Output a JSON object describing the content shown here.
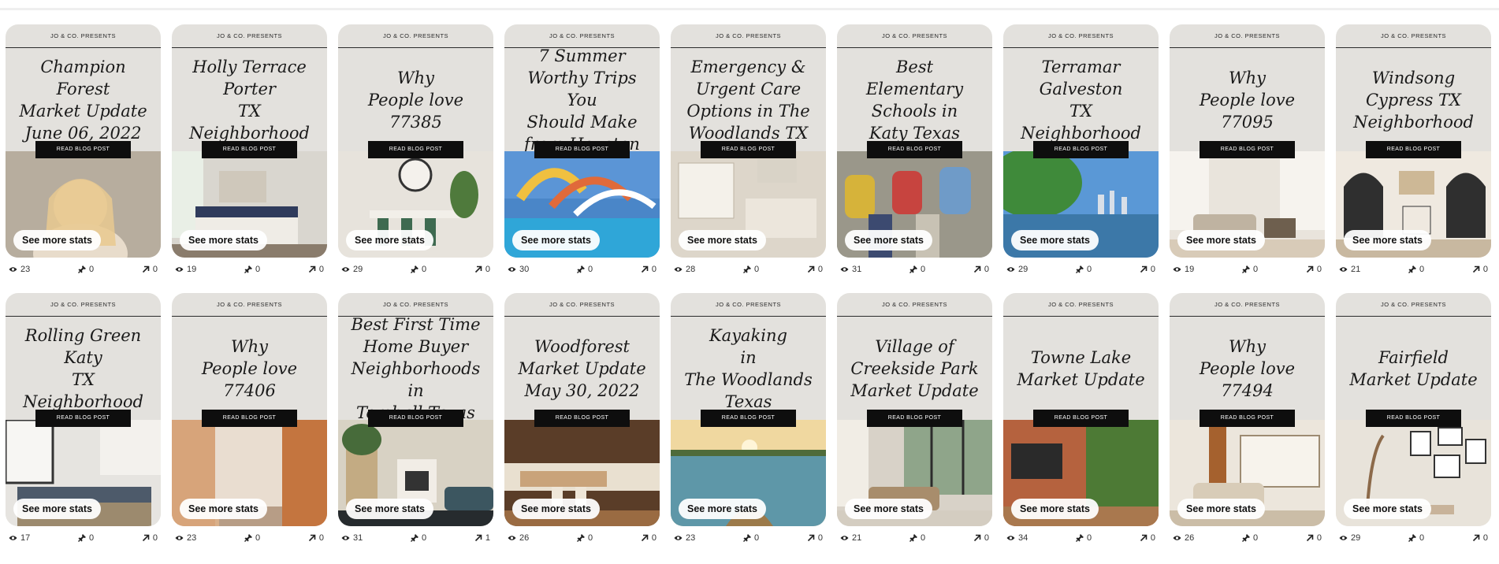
{
  "cards": [
    {
      "title": "Champion Forest\nMarket Update\nJune 06, 2022",
      "views": "23",
      "saves": "0",
      "clicks": "0",
      "scene": "portrait",
      "palette": [
        "#c9c2b6",
        "#7b6a55",
        "#e9d3b4"
      ]
    },
    {
      "title": "Holly Terrace\nPorter\nTX\nNeighborhood",
      "views": "19",
      "saves": "0",
      "clicks": "0",
      "scene": "bedroom",
      "palette": [
        "#d9d6cf",
        "#8a7c6c",
        "#f2efe8"
      ]
    },
    {
      "title": "Why\nPeople love\n77385",
      "views": "29",
      "saves": "0",
      "clicks": "0",
      "scene": "dining",
      "palette": [
        "#e7e3dc",
        "#3e6a50",
        "#b8ad9d"
      ]
    },
    {
      "title": "7 Summer\nWorthy Trips You\nShould Make\nfrom Houston",
      "views": "30",
      "saves": "0",
      "clicks": "0",
      "scene": "waterpark",
      "palette": [
        "#4a86c8",
        "#2fa8d8",
        "#e2b04a"
      ]
    },
    {
      "title": "Emergency &\nUrgent Care\nOptions in The\nWoodlands TX",
      "views": "28",
      "saves": "0",
      "clicks": "0",
      "scene": "clinic",
      "palette": [
        "#ddd6ca",
        "#a89a86",
        "#f4efe6"
      ]
    },
    {
      "title": "Best\nElementary\nSchools in\nKaty Texas",
      "views": "31",
      "saves": "0",
      "clicks": "0",
      "scene": "kids",
      "palette": [
        "#8c8a7e",
        "#d6b33a",
        "#c7443f"
      ]
    },
    {
      "title": "Terramar\nGalveston\nTX\nNeighborhood",
      "views": "29",
      "saves": "0",
      "clicks": "0",
      "scene": "lake",
      "palette": [
        "#5a98d6",
        "#3f8a3a",
        "#3c78a8"
      ]
    },
    {
      "title": "Why\nPeople love\n77095",
      "views": "19",
      "saves": "0",
      "clicks": "0",
      "scene": "living",
      "palette": [
        "#e9e4dc",
        "#bfb3a1",
        "#6e5f4e"
      ]
    },
    {
      "title": "Windsong\nCypress TX\nNeighborhood",
      "views": "21",
      "saves": "0",
      "clicks": "0",
      "scene": "arches",
      "palette": [
        "#efe9e0",
        "#2f2f2f",
        "#c8b8a0"
      ]
    },
    {
      "title": "Rolling Green\nKaty\nTX\nNeighborhood",
      "views": "17",
      "saves": "0",
      "clicks": "0",
      "scene": "kitchen",
      "palette": [
        "#e6e4e0",
        "#4d5a6a",
        "#9c8a6e"
      ]
    },
    {
      "title": "Why\nPeople love\n77406",
      "views": "23",
      "saves": "0",
      "clicks": "0",
      "scene": "street",
      "palette": [
        "#d9b08a",
        "#c4753f",
        "#e8d4bf"
      ]
    },
    {
      "title": "Best First Time\nHome Buyer\nNeighborhoods in\nTomball Texas",
      "views": "31",
      "saves": "0",
      "clicks": "1",
      "scene": "plants",
      "palette": [
        "#d8d2c4",
        "#476b3a",
        "#3c5660"
      ]
    },
    {
      "title": "Woodforest\nMarket Update\nMay 30, 2022",
      "views": "26",
      "saves": "0",
      "clicks": "0",
      "scene": "kitchen2",
      "palette": [
        "#5a3d28",
        "#c9a37a",
        "#efe6d8"
      ]
    },
    {
      "title": "Kayaking\nin\nThe Woodlands\nTexas",
      "views": "23",
      "saves": "0",
      "clicks": "0",
      "scene": "kayak",
      "palette": [
        "#f0d8a0",
        "#5e97a8",
        "#2f6a80"
      ]
    },
    {
      "title": "Village of\nCreekside Park\nMarket Update",
      "views": "21",
      "saves": "0",
      "clicks": "0",
      "scene": "sunroom",
      "palette": [
        "#d8d2c8",
        "#6b5a48",
        "#a88d6c"
      ]
    },
    {
      "title": "Towne Lake\nMarket Update",
      "views": "34",
      "saves": "0",
      "clicks": "0",
      "scene": "brickwall",
      "palette": [
        "#b5623e",
        "#4d7a35",
        "#2a2a2a"
      ]
    },
    {
      "title": "Why\nPeople love\n77494",
      "views": "26",
      "saves": "0",
      "clicks": "0",
      "scene": "bright",
      "palette": [
        "#ece6dc",
        "#a5612e",
        "#d8ccb8"
      ]
    },
    {
      "title": "Fairfield\nMarket Update",
      "views": "29",
      "saves": "0",
      "clicks": "0",
      "scene": "gallery",
      "palette": [
        "#e8e3da",
        "#8c6a4a",
        "#c8b39a"
      ]
    }
  ],
  "labels": {
    "presents": "JO & CO. PRESENTS",
    "cta": "READ BLOG POST",
    "stats_button": "See more stats"
  },
  "icons": {
    "views": "eye-icon",
    "saves": "pin-icon",
    "clicks": "outbound-arrow-icon"
  }
}
